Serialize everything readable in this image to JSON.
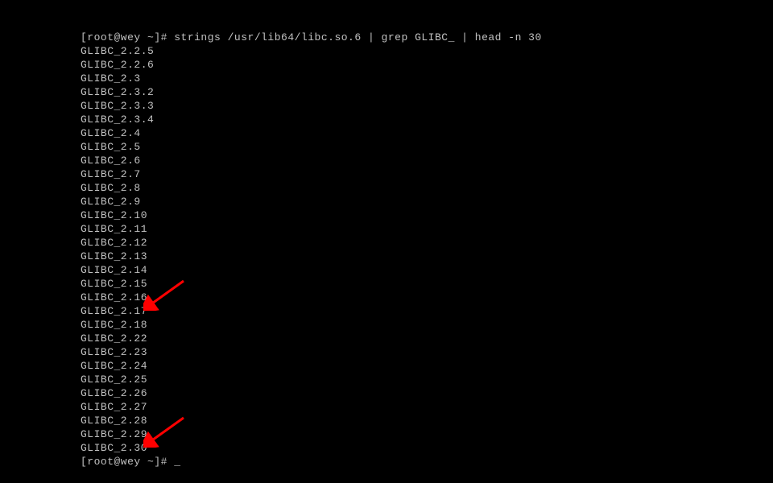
{
  "prompt1": "[root@wey ~]# strings /usr/lib64/libc.so.6 | grep GLIBC_ | head -n 30",
  "output": [
    "GLIBC_2.2.5",
    "GLIBC_2.2.6",
    "GLIBC_2.3",
    "GLIBC_2.3.2",
    "GLIBC_2.3.3",
    "GLIBC_2.3.4",
    "GLIBC_2.4",
    "GLIBC_2.5",
    "GLIBC_2.6",
    "GLIBC_2.7",
    "GLIBC_2.8",
    "GLIBC_2.9",
    "GLIBC_2.10",
    "GLIBC_2.11",
    "GLIBC_2.12",
    "GLIBC_2.13",
    "GLIBC_2.14",
    "GLIBC_2.15",
    "GLIBC_2.16",
    "GLIBC_2.17",
    "GLIBC_2.18",
    "GLIBC_2.22",
    "GLIBC_2.23",
    "GLIBC_2.24",
    "GLIBC_2.25",
    "GLIBC_2.26",
    "GLIBC_2.27",
    "GLIBC_2.28",
    "GLIBC_2.29",
    "GLIBC_2.30"
  ],
  "prompt2": "[root@wey ~]# ",
  "annotations": {
    "arrow1_target": "GLIBC_2.17",
    "arrow2_target": "GLIBC_2.30",
    "arrow_color": "#ff0000"
  }
}
